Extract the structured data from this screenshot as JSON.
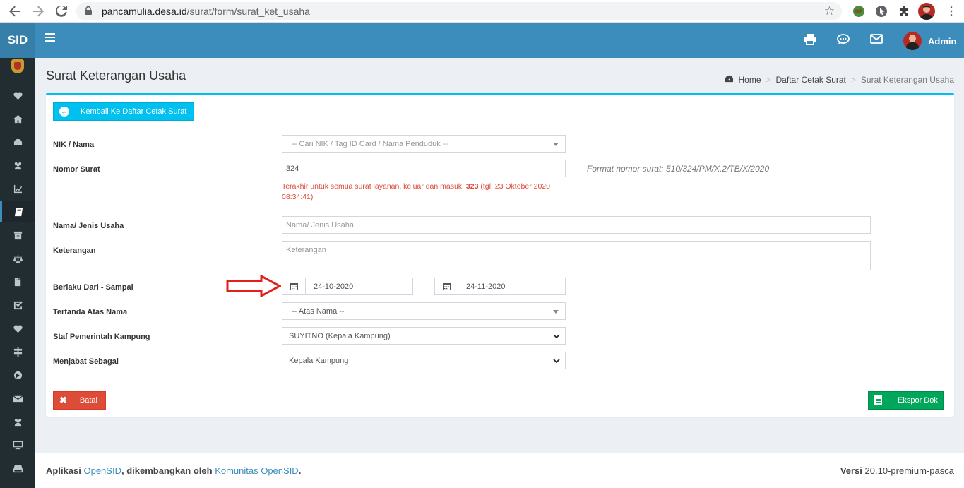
{
  "browser": {
    "url_host": "pancamulia.desa.id",
    "url_path": "/surat/form/surat_ket_usaha"
  },
  "header": {
    "logo": "SID",
    "user_name": "Admin"
  },
  "page": {
    "title": "Surat Keterangan Usaha",
    "breadcrumb": [
      "Home",
      "Daftar Cetak Surat",
      "Surat Keterangan Usaha"
    ]
  },
  "form": {
    "back_button": "Kembali Ke Daftar Cetak Surat",
    "nik_label": "NIK / Nama",
    "nik_placeholder": "-- Cari NIK / Tag ID Card / Nama Penduduk --",
    "nomor_label": "Nomor Surat",
    "nomor_value": "324",
    "nomor_help_prefix": "Terakhir untuk semua surat layanan, keluar dan masuk:",
    "nomor_help_number": "323",
    "nomor_help_suffix": "(tgl: 23 Oktober 2020 08:34:41)",
    "format_note": "Format nomor surat: 510/324/PM/X.2/TB/X/2020",
    "usaha_label": "Nama/ Jenis Usaha",
    "usaha_placeholder": "Nama/ Jenis Usaha",
    "keterangan_label": "Keterangan",
    "keterangan_placeholder": "Keterangan",
    "berlaku_label": "Berlaku Dari - Sampai",
    "berlaku_dari": "24-10-2020",
    "berlaku_sampai": "24-11-2020",
    "tertanda_label": "Tertanda Atas Nama",
    "tertanda_placeholder": "-- Atas Nama --",
    "staf_label": "Staf Pemerintah Kampung",
    "staf_value": "SUYITNO (Kepala Kampung)",
    "jabatan_label": "Menjabat Sebagai",
    "jabatan_value": "Kepala Kampung",
    "cancel_button": "Batal",
    "export_button": "Ekspor Dok"
  },
  "footer": {
    "prefix": "Aplikasi",
    "app_link": "OpenSID",
    "middle": ", dikembangkan oleh",
    "community_link": "Komunitas OpenSID",
    "suffix": ".",
    "version_label": "Versi",
    "version_value": "20.10-premium-pasca"
  },
  "colors": {
    "primary": "#3c8dbc",
    "info": "#00c0ef",
    "danger": "#dd4b39",
    "success": "#00a65a",
    "sidebar": "#222d32",
    "annotation_arrow": "#e0201b"
  },
  "sidebar_icons": [
    "heartbeat-icon",
    "home-icon",
    "dashboard-icon",
    "users-icon",
    "line-chart-icon",
    "book-icon",
    "archive-icon",
    "balance-scale-icon",
    "files-icon",
    "check-square-icon",
    "heart-icon",
    "signpost-icon",
    "globe-icon",
    "envelope-icon",
    "group-icon",
    "desktop-icon",
    "hdd-icon"
  ]
}
